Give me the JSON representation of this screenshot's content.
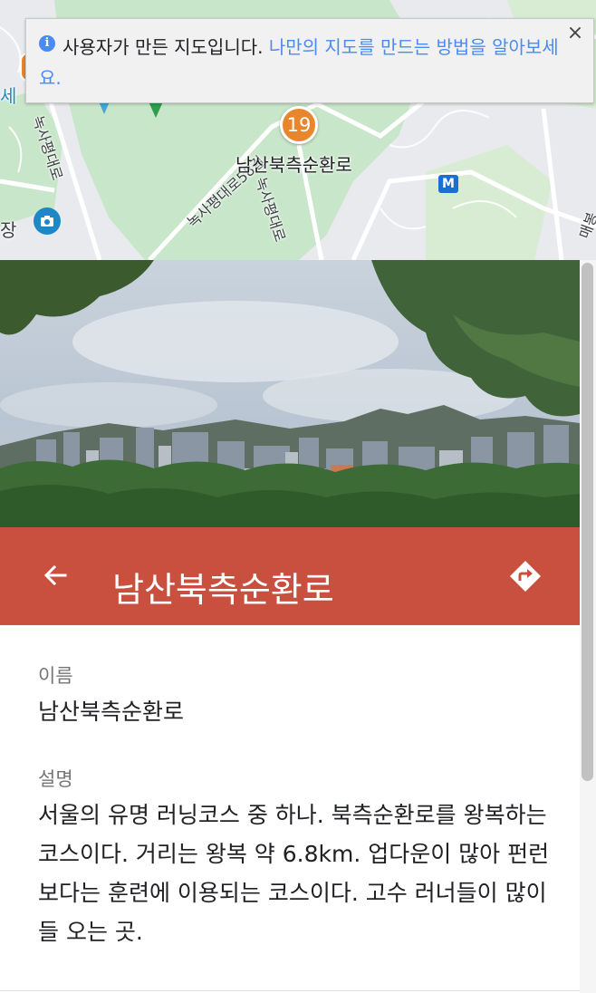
{
  "map": {
    "banner": {
      "message": "사용자가 만든 지도입니다.",
      "link": "나만의 지도를 만드는 방법을 알아보세요."
    },
    "pin_number": "19",
    "pin_label": "남산북측순환로",
    "road_labels": [
      "녹사평대로",
      "녹사평대로58길",
      "녹사평대로"
    ],
    "place_labels": [
      "세",
      "장",
      "매봉"
    ],
    "metro_symbol": "M",
    "close_symbol": "×",
    "info_symbol": "i"
  },
  "header": {
    "title": "남산북측순환로",
    "back_icon": "arrow-left-icon",
    "directions_icon": "directions-icon",
    "background_color": "#c9503f"
  },
  "details": {
    "name_label": "이름",
    "name_value": "남산북측순환로",
    "description_label": "설명",
    "description_value": "서울의 유명 러닝코스 중 하나. 북측순환로를 왕복하는 코스이다. 거리는 왕복 약 6.8km. 업다운이 많아 펀런 보다는 훈련에 이용되는 코스이다. 고수 러너들이 많이들 오는 곳."
  }
}
